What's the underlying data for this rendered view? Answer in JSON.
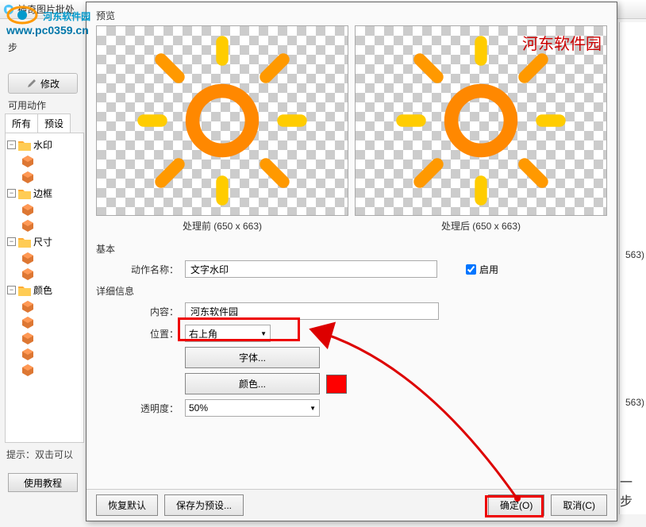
{
  "titlebar": {
    "text": "神奇图片批处"
  },
  "logo": {
    "name": "河东软件园",
    "url": "www.pc0359.cn"
  },
  "step": {
    "label": "步"
  },
  "modify": {
    "label": "修改"
  },
  "actions": {
    "title": "可用动作",
    "tab_all": "所有",
    "tab_preset": "预设",
    "nodes": {
      "watermark": "水印",
      "border": "边框",
      "size": "尺寸",
      "color": "颜色"
    }
  },
  "hint": "提示：双击可以",
  "tutorial": "使用教程",
  "preview": {
    "title": "预览",
    "before": "处理前 (650 x 663)",
    "after": "处理后 (650 x 663)",
    "watermark_sample": "河东软件园"
  },
  "basic": {
    "title": "基本",
    "action_name_label": "动作名称：",
    "action_name": "文字水印",
    "enable": "启用"
  },
  "detail": {
    "title": "详细信息",
    "content_label": "内容：",
    "content": "河东软件园",
    "position_label": "位置：",
    "position": "右上角",
    "font_btn": "字体...",
    "color_btn": "颜色...",
    "opacity_label": "透明度：",
    "opacity": "50%"
  },
  "footer": {
    "restore": "恢复默认",
    "save_preset": "保存为预设...",
    "ok": "确定(O)",
    "cancel": "取消(C)"
  },
  "right": {
    "dim1": "563)",
    "dim2": "563)",
    "step": "一步"
  }
}
